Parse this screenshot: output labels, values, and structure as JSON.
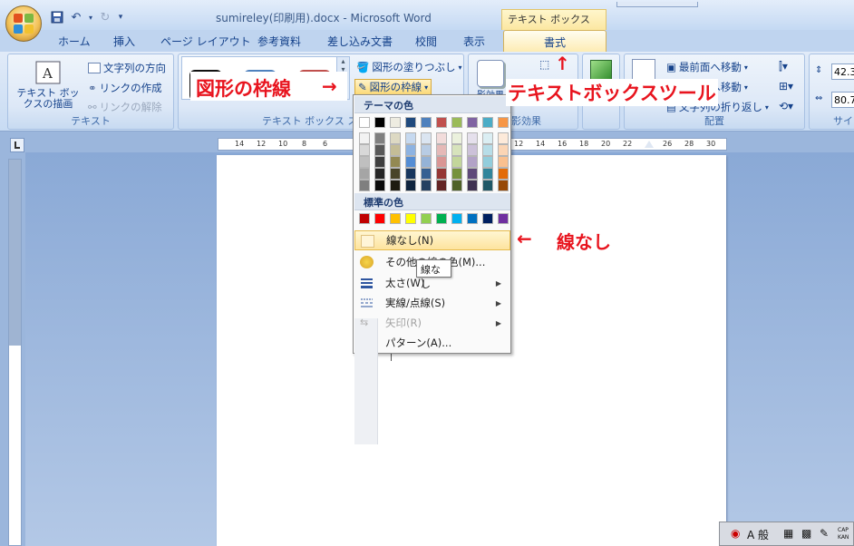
{
  "window": {
    "title": "sumireley(印刷用).docx - Microsoft Word",
    "context_tab_title": "テキスト ボックス ツール"
  },
  "tabs": [
    "ホーム",
    "挿入",
    "ページ レイアウト",
    "参考資料",
    "差し込み文書",
    "校閲",
    "表示",
    "書式"
  ],
  "ribbon": {
    "text_group": {
      "label": "テキスト",
      "draw_button": "テキスト ボックスの描画",
      "text_direction": "文字列の方向",
      "create_link": "リンクの作成",
      "break_link": "リンクの解除"
    },
    "styles_group": {
      "label": "テキスト ボックス スタイ",
      "fill": "図形の塗りつぶし",
      "outline": "図形の枠線"
    },
    "shadow_group": {
      "shadow_button": "影効果",
      "label": "影効果"
    },
    "threed_group": {
      "button": "効果"
    },
    "arrange_group": {
      "label": "配置",
      "bring_front": "最前面へ移動",
      "send_back": "最背面へ移動",
      "wrap": "文字列の折り返し"
    },
    "size_group": {
      "label": "サイ",
      "height": "42.33",
      "width": "80.7"
    }
  },
  "ruler": {
    "ticks": [
      "14",
      "12",
      "10",
      "8",
      "6",
      "4",
      "2",
      "",
      "",
      "",
      "",
      "",
      "",
      "12",
      "14",
      "16",
      "18",
      "20",
      "22",
      "24",
      "26",
      "28",
      "30"
    ]
  },
  "menu": {
    "theme_colors_header": "テーマの色",
    "standard_colors_header": "標準の色",
    "theme_colors_top": [
      "#ffffff",
      "#000000",
      "#eeece1",
      "#1f497d",
      "#4f81bd",
      "#c0504d",
      "#9bbb59",
      "#8064a2",
      "#4bacc6",
      "#f79646"
    ],
    "theme_shades": [
      [
        "#f2f2f2",
        "#7f7f7f",
        "#ddd9c3",
        "#c6d9f0",
        "#dbe5f1",
        "#f2dcdb",
        "#ebf1dd",
        "#e5e0ec",
        "#dbeef3",
        "#fdeada"
      ],
      [
        "#d8d8d8",
        "#595959",
        "#c4bd97",
        "#8db3e2",
        "#b8cce4",
        "#e5b9b7",
        "#d7e3bc",
        "#ccc1d9",
        "#b7dde8",
        "#fbd5b5"
      ],
      [
        "#bfbfbf",
        "#3f3f3f",
        "#938953",
        "#548dd4",
        "#95b3d7",
        "#d99694",
        "#c3d69b",
        "#b2a2c7",
        "#92cddc",
        "#fac08f"
      ],
      [
        "#a5a5a5",
        "#262626",
        "#494429",
        "#17365d",
        "#366092",
        "#953734",
        "#76923c",
        "#5f497a",
        "#31859b",
        "#e36c09"
      ],
      [
        "#7f7f7f",
        "#0c0c0c",
        "#1d1b10",
        "#0f243e",
        "#244061",
        "#632423",
        "#4f6128",
        "#3f3151",
        "#205867",
        "#974806"
      ]
    ],
    "standard_colors": [
      "#c00000",
      "#ff0000",
      "#ffc000",
      "#ffff00",
      "#92d050",
      "#00b050",
      "#00b0f0",
      "#0070c0",
      "#002060",
      "#7030a0"
    ],
    "items": [
      {
        "label": "線なし(N)",
        "has_submenu": false
      },
      {
        "label": "その他の線の色(M)...",
        "has_submenu": false
      },
      {
        "label": "太さ(W)",
        "has_submenu": true
      },
      {
        "label": "実線/点線(S)",
        "has_submenu": true
      },
      {
        "label": "矢印(R)",
        "has_submenu": true
      },
      {
        "label": "パターン(A)...",
        "has_submenu": false
      }
    ],
    "tooltip": "線なし"
  },
  "annotations": {
    "outline": "図形の枠線",
    "outline_arrow": "→",
    "textbox_tools": "テキストボックスツール",
    "up_arrow": "↑",
    "no_line_arrow": "←",
    "no_line": "線なし"
  },
  "taskbar": {
    "ime_mode": "A 般",
    "label": "CAP KAN"
  }
}
